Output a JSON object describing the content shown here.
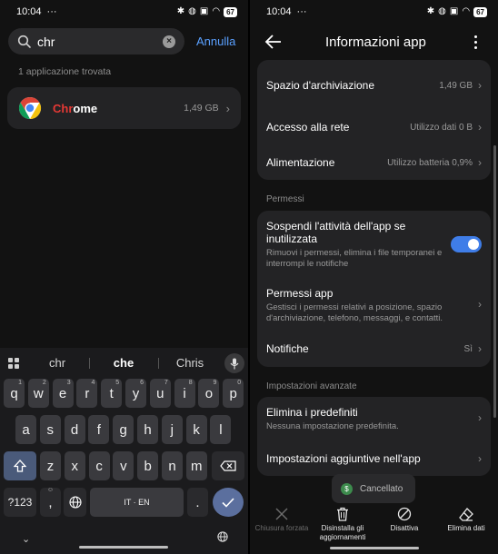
{
  "status_left": {
    "time": "10:04",
    "dots": "···"
  },
  "status_right": {
    "time": "10:04",
    "dots": "···"
  },
  "battery_level": "67",
  "search": {
    "query": "chr",
    "placeholder": "",
    "cancel_label": "Annulla"
  },
  "results_count_text": "1 applicazione trovata",
  "result": {
    "name_highlight": "Chr",
    "name_rest": "ome",
    "size": "1,49 GB"
  },
  "keyboard": {
    "suggestions": [
      "chr",
      "che",
      "Chris"
    ],
    "row1": [
      {
        "k": "q",
        "n": "1"
      },
      {
        "k": "w",
        "n": "2"
      },
      {
        "k": "e",
        "n": "3"
      },
      {
        "k": "r",
        "n": "4"
      },
      {
        "k": "t",
        "n": "5"
      },
      {
        "k": "y",
        "n": "6"
      },
      {
        "k": "u",
        "n": "7"
      },
      {
        "k": "i",
        "n": "8"
      },
      {
        "k": "o",
        "n": "9"
      },
      {
        "k": "p",
        "n": "0"
      }
    ],
    "row2": [
      "a",
      "s",
      "d",
      "f",
      "g",
      "h",
      "j",
      "k",
      "l"
    ],
    "row3": [
      "z",
      "x",
      "c",
      "v",
      "b",
      "n",
      "m"
    ],
    "sym_label": "?123",
    "comma": ",",
    "space_label": "IT · EN",
    "period": "."
  },
  "app_info": {
    "title": "Informazioni app",
    "storage": {
      "label": "Spazio d'archiviazione",
      "value": "1,49 GB"
    },
    "network": {
      "label": "Accesso alla rete",
      "value": "Utilizzo dati 0 B"
    },
    "power": {
      "label": "Alimentazione",
      "value": "Utilizzo batteria 0,9%"
    },
    "permissions_header": "Permessi",
    "suspend": {
      "label": "Sospendi l'attività dell'app se inutilizzata",
      "sub": "Rimuovi i permessi, elimina i file temporanei e interrompi le notifiche",
      "enabled": true
    },
    "app_permissions": {
      "label": "Permessi app",
      "sub": "Gestisci i permessi relativi a posizione, spazio d'archiviazione, telefono, messaggi, e contatti."
    },
    "notifications": {
      "label": "Notifiche",
      "value": "Sì"
    },
    "advanced_header": "Impostazioni avanzate",
    "defaults": {
      "label": "Elimina i predefiniti",
      "sub": "Nessuna impostazione predefinita."
    },
    "extra_settings": {
      "label": "Impostazioni aggiuntive nell'app"
    },
    "toast": "Cancellato",
    "actions": [
      {
        "label": "Chiusura forzata",
        "enabled": false,
        "icon": "close-x-icon"
      },
      {
        "label": "Disinstalla gli aggiornamenti",
        "enabled": true,
        "icon": "trash-icon"
      },
      {
        "label": "Disattiva",
        "enabled": true,
        "icon": "disable-icon"
      },
      {
        "label": "Elimina dati",
        "enabled": true,
        "icon": "eraser-icon"
      }
    ]
  },
  "colors": {
    "accent": "#3f7de8",
    "link": "#5aa0ff",
    "highlight": "#e53935",
    "background": "#121212",
    "card": "#232325"
  }
}
